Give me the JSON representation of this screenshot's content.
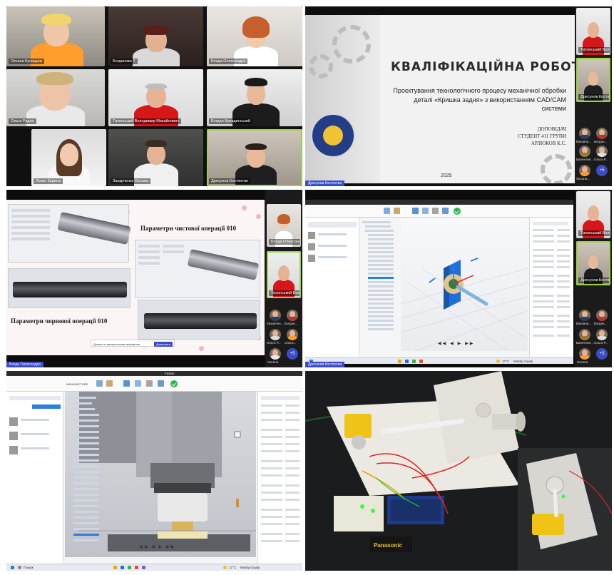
{
  "panel1": {
    "participants": [
      {
        "name": "Оксана Куницька"
      },
      {
        "name": "Богданова Т"
      },
      {
        "name": "Бохда Олександра"
      },
      {
        "name": "Ольга Радно"
      },
      {
        "name": "Тихонський Володимир Михайлович"
      },
      {
        "name": "Богдан Кривдинський"
      },
      {
        "name": "Лукин Карина"
      },
      {
        "name": "Захарченко Оксана"
      },
      {
        "name": "Дресунов Костянтин"
      }
    ]
  },
  "panel2": {
    "slide": {
      "title": "КВАЛІФІКАЦІЙНА РОБОТА",
      "subtitle": "Проєктування технологічного процесу механічної обробки деталі «Кришка задня» з використанням CAD/CAM системи",
      "reporter_label": "ДОПОВІДАЧ",
      "reporter_group": "СТУДЕНТ 411 ГРУПИ",
      "reporter_name": "АРЛЮКОВ К.С.",
      "year": "2025"
    },
    "side": {
      "top_name": "Тихонський Володимир",
      "second_name": "Дресунов Костянтин",
      "grid": [
        "Ваковна...",
        "Богдан...",
        "Валентин...",
        "Ольга Р...",
        "Оксана...",
        "Ольга..."
      ],
      "more": "+5"
    },
    "bottom_tag": "Дресунов Костянтин"
  },
  "panel3": {
    "finish_title": "Параметри чистової операції 010",
    "rough_title": "Параметри чорнової операції 010",
    "side": {
      "top_name": "Бохда Олександра",
      "second_name": "Тихонський Володимир",
      "grid": [
        "Захарчен...",
        "Богдан...",
        "Ольга Р...",
        "Ольга..."
      ],
      "last_row": [
        "Оксана",
        "Ольга"
      ],
      "more": "+5"
    },
    "notification": "Дозвіл на використання мікрофона",
    "notification_button": "Дозволити",
    "bottom_tag": "Бохда Олександра"
  },
  "panel4": {
    "side": {
      "top_name": "Тихонський Володимир",
      "second_name": "Дресунов Костянтин",
      "grid": [
        "Ваковна...",
        "Богдан...",
        "Валентин...",
        "Ольга Р..."
      ],
      "last_row": [
        "Оксана",
        "Ольга"
      ],
      "more": "+5"
    },
    "taskbar": {
      "weather": "17°C",
      "weather_desc": "Mostly cloudy"
    },
    "bottom_tag": "Дресунов Костянтин"
  },
  "panel5": {
    "app_title": "Fusion",
    "toolbar_label": "MANUFACTURE",
    "taskbar": {
      "search": "Пошук",
      "weather": "17°C",
      "weather_desc": "Mostly cloudy"
    }
  },
  "panel6": {
    "battery_label": "Panasonic"
  },
  "colors": {
    "accent": "#3a4cc9",
    "highlight": "#9ad14b",
    "ok": "#2fb54a",
    "cube": "#1e6fd9",
    "motor": "#f0c417"
  }
}
